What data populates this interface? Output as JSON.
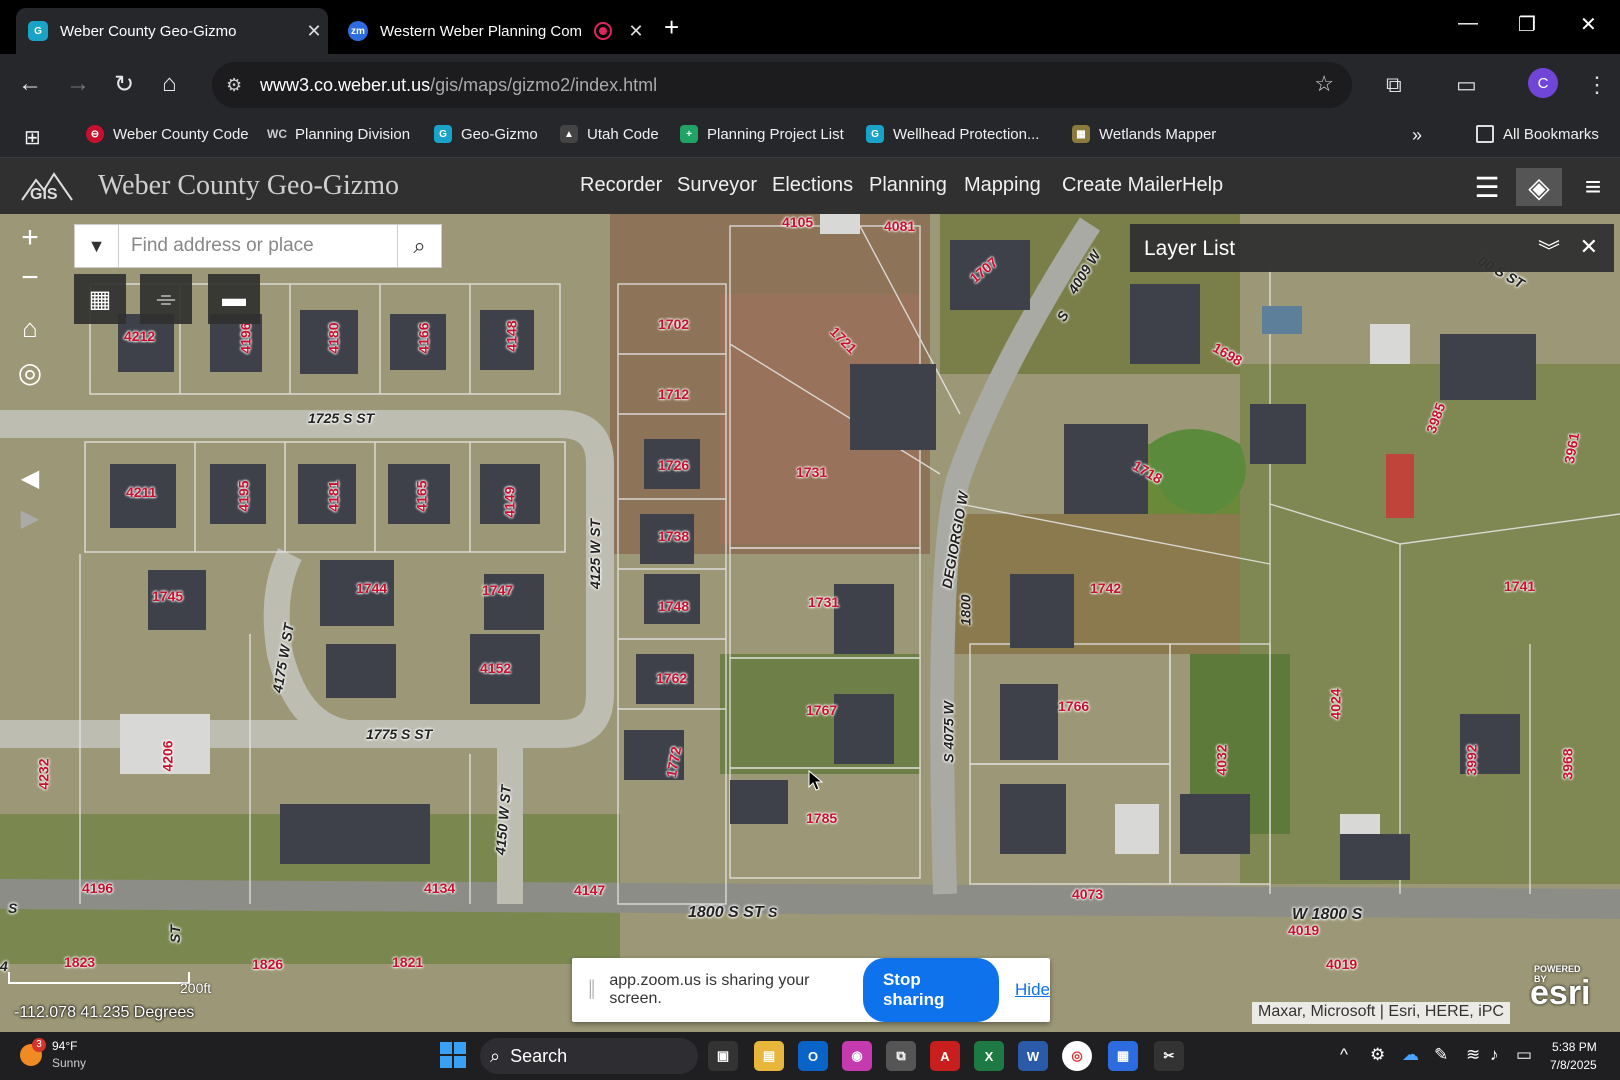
{
  "browser": {
    "tabs": [
      {
        "title": "Weber County Geo-Gizmo",
        "active": true
      },
      {
        "title": "Western Weber Planning Com",
        "active": false
      }
    ],
    "url_host": "www3.co.weber.ut.us",
    "url_path": "/gis/maps/gizmo2/index.html",
    "avatar_letter": "C",
    "bookmarks": [
      "Weber County Code",
      "Planning Division",
      "Geo-Gizmo",
      "Utah Code",
      "Planning Project List",
      "Wellhead Protection...",
      "Wetlands Mapper"
    ],
    "all_bookmarks": "All Bookmarks"
  },
  "app": {
    "logo_text": "GIS",
    "title": "Weber County Geo-Gizmo",
    "menu": [
      "Recorder",
      "Surveyor",
      "Elections",
      "Planning",
      "Mapping",
      "Create Mailer",
      "Help"
    ]
  },
  "map": {
    "search_placeholder": "Find address or place",
    "layer_panel_title": "Layer List",
    "parcel_labels": [
      "4105",
      "4081",
      "1707",
      "4009 W",
      "1721",
      "1702",
      "1712",
      "1726",
      "1738",
      "1748",
      "1762",
      "1772",
      "1731",
      "1731",
      "1767",
      "1785",
      "1742",
      "1766",
      "1718",
      "1698",
      "3985",
      "3961",
      "1741",
      "4024",
      "4032",
      "3992",
      "3968",
      "4212",
      "4196",
      "4180",
      "4166",
      "4148",
      "4211",
      "4195",
      "4181",
      "4165",
      "4149",
      "1745",
      "1744",
      "1747",
      "4152",
      "4232",
      "4206",
      "4196",
      "4134",
      "4147",
      "4073",
      "4019",
      "4019",
      "1823",
      "1826",
      "1821"
    ],
    "street_labels": [
      "1725 S ST",
      "4125 W ST",
      "4175 W ST",
      "1775 S ST",
      "4150 W ST",
      "DEGIORGIO W",
      "1800",
      "S 4075 W",
      "1800 S ST",
      "W 1800 S",
      "S",
      "S",
      "S",
      "ST",
      "4",
      "00 S ST"
    ],
    "scale_label": "200ft",
    "coordinates": "-112.078 41.235 Degrees",
    "attribution": "Maxar, Microsoft | Esri, HERE, iPC",
    "esri_powered": "POWERED BY",
    "esri_logo": "esri"
  },
  "zoom_share": {
    "message": "app.zoom.us is sharing your screen.",
    "stop_label": "Stop sharing",
    "hide_label": "Hide"
  },
  "taskbar": {
    "weather_temp": "94°F",
    "weather_cond": "Sunny",
    "weather_badge": "3",
    "search_label": "Search",
    "time": "5:38 PM",
    "date": "7/8/2025"
  }
}
